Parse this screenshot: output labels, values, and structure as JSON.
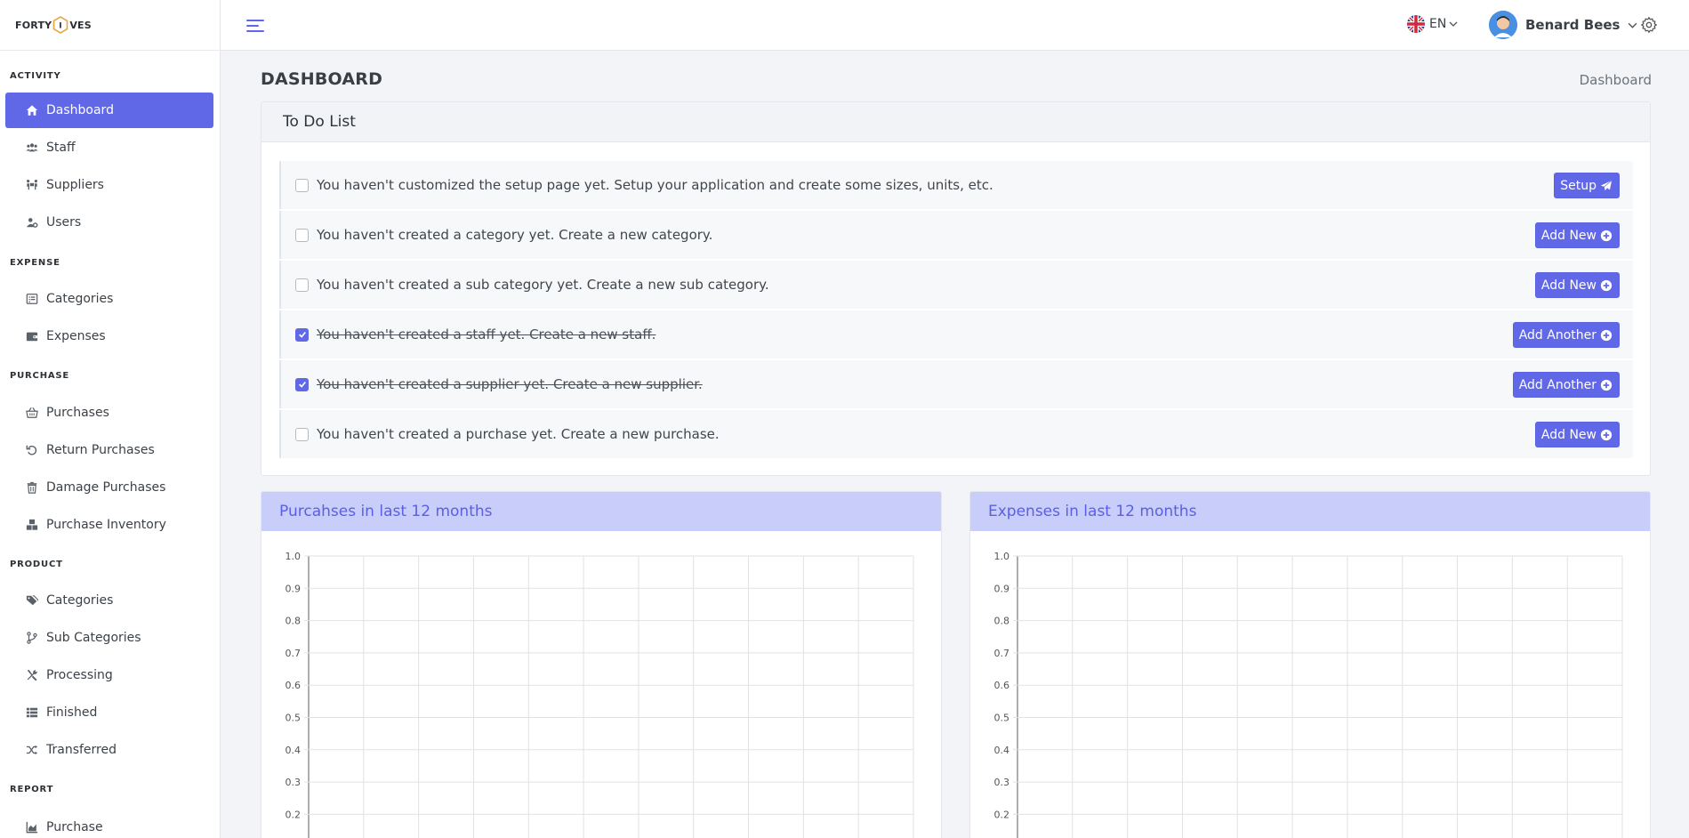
{
  "app": {
    "logo_left": "FORTY",
    "logo_right": "VES"
  },
  "sidebar": {
    "sections": [
      {
        "title": "ACTIVITY",
        "items": [
          {
            "label": "Dashboard",
            "icon": "home-icon",
            "active": true
          },
          {
            "label": "Staff",
            "icon": "users-group-icon"
          },
          {
            "label": "Suppliers",
            "icon": "people-carry-icon"
          },
          {
            "label": "Users",
            "icon": "users-cog-icon"
          }
        ]
      },
      {
        "title": "EXPENSE",
        "items": [
          {
            "label": "Categories",
            "icon": "list-alt-icon"
          },
          {
            "label": "Expenses",
            "icon": "wallet-icon"
          }
        ]
      },
      {
        "title": "PURCHASE",
        "items": [
          {
            "label": "Purchases",
            "icon": "basket-icon"
          },
          {
            "label": "Return Purchases",
            "icon": "undo-icon"
          },
          {
            "label": "Damage Purchases",
            "icon": "trash-icon"
          },
          {
            "label": "Purchase Inventory",
            "icon": "boxes-icon"
          }
        ]
      },
      {
        "title": "PRODUCT",
        "items": [
          {
            "label": "Categories",
            "icon": "tags-icon"
          },
          {
            "label": "Sub Categories",
            "icon": "code-branch-icon"
          },
          {
            "label": "Processing",
            "icon": "tools-icon"
          },
          {
            "label": "Finished",
            "icon": "th-list-icon"
          },
          {
            "label": "Transferred",
            "icon": "random-icon"
          }
        ]
      },
      {
        "title": "REPORT",
        "items": [
          {
            "label": "Purchase",
            "icon": "chart-area-icon"
          }
        ]
      }
    ]
  },
  "topbar": {
    "language": "EN",
    "user_name": "Benard Bees"
  },
  "page": {
    "title": "DASHBOARD",
    "breadcrumb": "Dashboard"
  },
  "todo": {
    "title": "To Do List",
    "items": [
      {
        "text": "You haven't customized the setup page yet. Setup your application and create some sizes, units, etc.",
        "done": false,
        "button": "Setup",
        "button_icon": "paper-plane-icon"
      },
      {
        "text": "You haven't created a category yet. Create a new category.",
        "done": false,
        "button": "Add New",
        "button_icon": "plus-circle-icon"
      },
      {
        "text": "You haven't created a sub category yet. Create a new sub category.",
        "done": false,
        "button": "Add New",
        "button_icon": "plus-circle-icon"
      },
      {
        "text": "You haven't created a staff yet. Create a new staff.",
        "done": true,
        "button": "Add Another",
        "button_icon": "plus-circle-icon"
      },
      {
        "text": "You haven't created a supplier yet. Create a new supplier.",
        "done": true,
        "button": "Add Another",
        "button_icon": "plus-circle-icon"
      },
      {
        "text": "You haven't created a purchase yet. Create a new purchase.",
        "done": false,
        "button": "Add New",
        "button_icon": "plus-circle-icon"
      }
    ]
  },
  "charts": {
    "purchases_title": "Purcahses in last 12 months",
    "expenses_title": "Expenses in last 12 months"
  },
  "chart_data": [
    {
      "type": "line",
      "title": "Purcahses in last 12 months",
      "xlabel": "",
      "ylabel": "",
      "ylim": [
        0,
        1.0
      ],
      "yticks": [
        "1.0",
        "0.9",
        "0.8",
        "0.7",
        "0.6",
        "0.5",
        "0.4",
        "0.3",
        "0.2"
      ],
      "series": [],
      "grid": true
    },
    {
      "type": "line",
      "title": "Expenses in last 12 months",
      "xlabel": "",
      "ylabel": "",
      "ylim": [
        0,
        1.0
      ],
      "yticks": [
        "1.0",
        "0.9",
        "0.8",
        "0.7",
        "0.6",
        "0.5",
        "0.4",
        "0.3",
        "0.2"
      ],
      "series": [],
      "grid": true
    }
  ],
  "colors": {
    "accent": "#6068e8",
    "chart_header_bg": "#c9cdfa",
    "chart_header_text": "#5960e4"
  }
}
